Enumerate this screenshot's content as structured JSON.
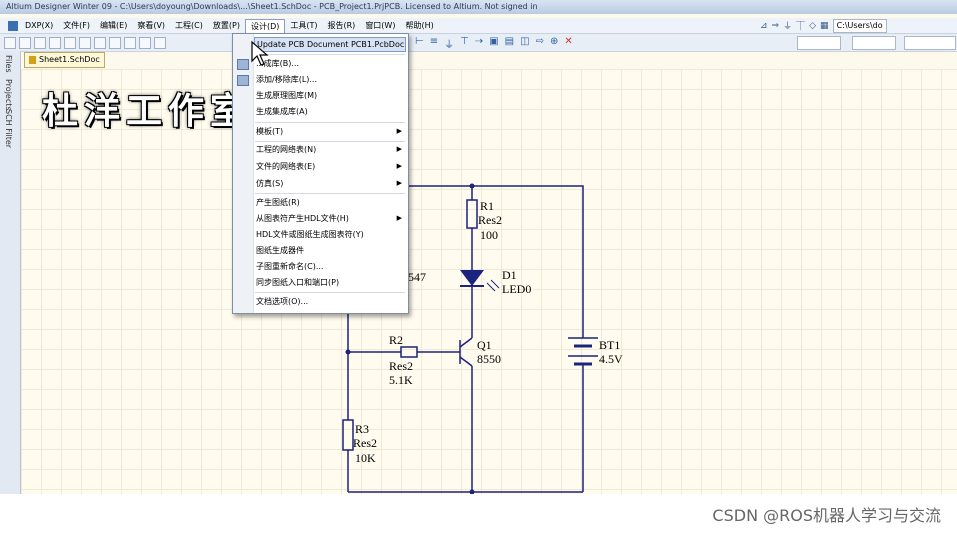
{
  "window": {
    "title": "Altium Designer Winter 09 - C:\\Users\\doyoung\\Downloads\\...\\Sheet1.SchDoc - PCB_Project1.PrjPCB. Licensed to Altium. Not signed in"
  },
  "menubar": {
    "items": [
      "DXP(X)",
      "文件(F)",
      "编辑(E)",
      "察看(V)",
      "工程(C)",
      "放置(P)",
      "设计(D)",
      "工具(T)",
      "报告(R)",
      "窗口(W)",
      "帮助(H)"
    ],
    "active_index": 6,
    "path_text": "C:\\Users\\do"
  },
  "doc_tab": {
    "label": "Sheet1.SchDoc"
  },
  "side_panel": {
    "tabs": [
      "Files",
      "Projects",
      "SCH Filter"
    ]
  },
  "watermark": {
    "text": "杜洋工作室"
  },
  "design_menu": {
    "items": [
      {
        "label": "Update PCB Document PCB1.PcbDoc",
        "highlight": true,
        "arrow": false
      },
      {
        "label": "...成库(B)...",
        "arrow": false
      },
      {
        "label": "添加/移除库(L)...",
        "arrow": false
      },
      {
        "label": "生成原理图库(M)",
        "arrow": false
      },
      {
        "label": "生成集成库(A)",
        "arrow": false
      },
      {
        "label": "模板(T)",
        "arrow": true
      },
      {
        "label": "工程的网络表(N)",
        "arrow": true
      },
      {
        "label": "文件的网络表(E)",
        "arrow": true
      },
      {
        "label": "仿真(S)",
        "arrow": true
      },
      {
        "label": "产生图纸(R)",
        "arrow": false
      },
      {
        "label": "从图表符产生HDL文件(H)",
        "arrow": true
      },
      {
        "label": "HDL文件或图纸生成图表符(Y)",
        "arrow": false
      },
      {
        "label": "图纸生成器件",
        "arrow": false
      },
      {
        "label": "子图重新命名(C)...",
        "arrow": false
      },
      {
        "label": "同步图纸入口和端口(P)",
        "arrow": false
      },
      {
        "label": "文档选项(O)...",
        "arrow": false
      }
    ]
  },
  "schematic": {
    "components": {
      "r1": {
        "designator": "R1",
        "type": "Res2",
        "value": "100"
      },
      "d1": {
        "designator": "D1",
        "value": "LED0"
      },
      "q1": {
        "designator": "Q1",
        "value": "8550"
      },
      "r2": {
        "designator": "R2",
        "type": "Res2",
        "value": "5.1K"
      },
      "r3": {
        "designator": "R3",
        "type": "Res2",
        "value": "10K"
      },
      "bt1": {
        "designator": "BT1",
        "value": "4.5V"
      },
      "partial": {
        "value": "547"
      }
    },
    "wire_color": "#1a237e",
    "component_color": "#1a237e"
  },
  "credit": {
    "text": "CSDN @ROS机器人学习与交流"
  }
}
